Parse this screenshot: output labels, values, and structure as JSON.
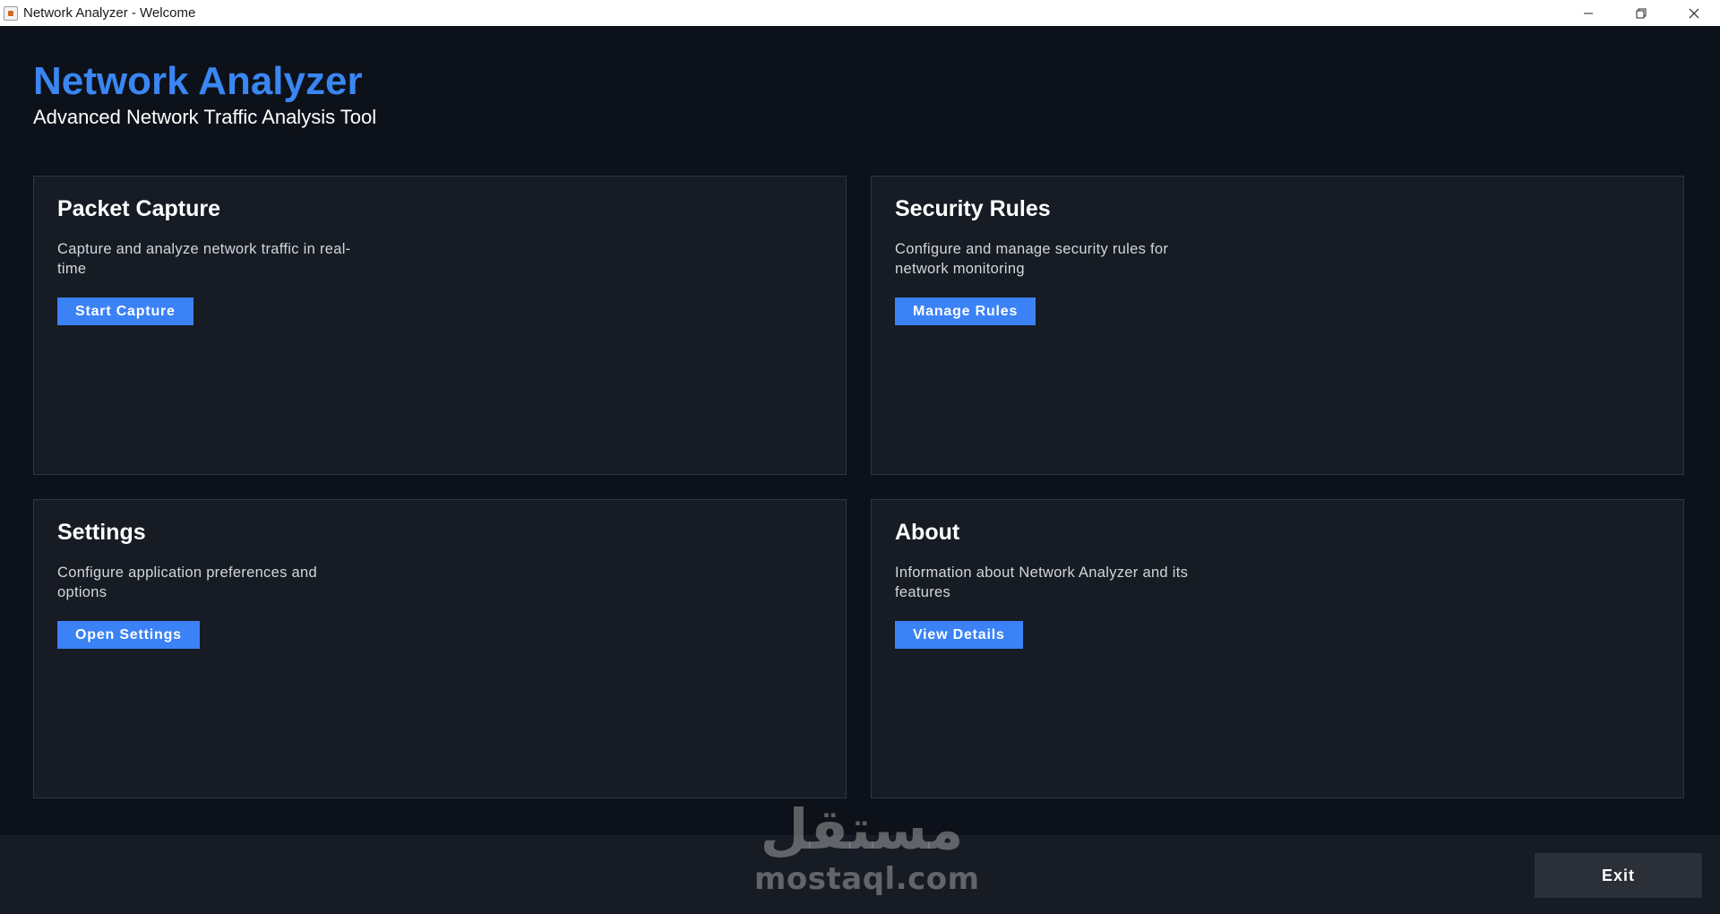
{
  "window": {
    "title": "Network Analyzer - Welcome",
    "controls": [
      "minimize-icon",
      "restore-icon",
      "close-icon"
    ]
  },
  "header": {
    "title": "Network Analyzer",
    "subtitle": "Advanced Network Traffic Analysis Tool"
  },
  "cards": [
    {
      "title": "Packet Capture",
      "description": "Capture and analyze network traffic in real-time",
      "button": "Start Capture"
    },
    {
      "title": "Security Rules",
      "description": "Configure and manage security rules for network monitoring",
      "button": "Manage Rules"
    },
    {
      "title": "Settings",
      "description": "Configure application preferences and options",
      "button": "Open Settings"
    },
    {
      "title": "About",
      "description": "Information about Network Analyzer and its features",
      "button": "View Details"
    }
  ],
  "footer": {
    "exit_label": "Exit"
  },
  "watermark": {
    "arabic": "مستقل",
    "latin": "mostaql.com"
  },
  "colors": {
    "accent": "#3b82f6",
    "title_blue": "#3a86f2",
    "background": "#0d1119",
    "card": "#161b24",
    "exit_button": "#2a2f38"
  }
}
